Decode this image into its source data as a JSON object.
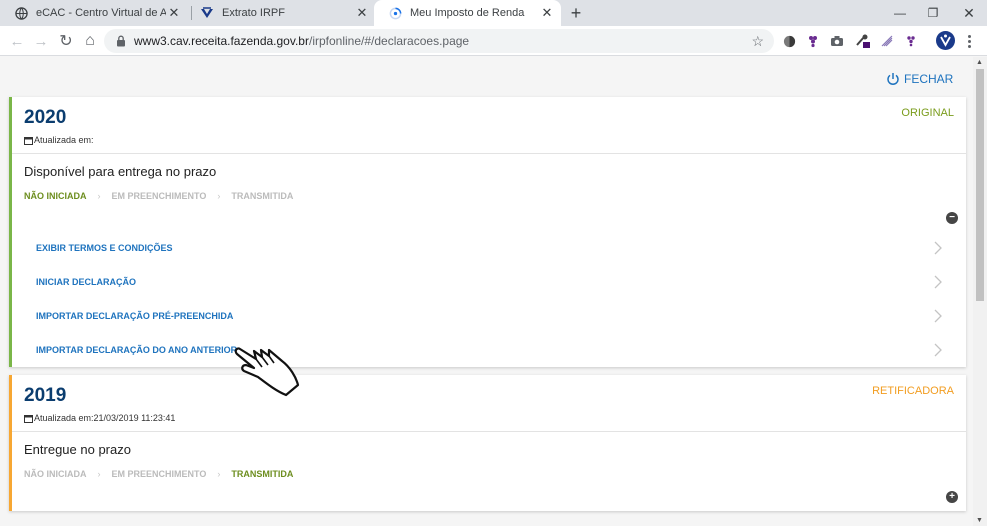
{
  "browser": {
    "tabs": [
      {
        "title": "eCAC - Centro Virtual de Atendim",
        "icon": "globe-icon",
        "active": false
      },
      {
        "title": "Extrato IRPF",
        "icon": "receita-federal-icon",
        "active": false
      },
      {
        "title": "Meu Imposto de Renda",
        "icon": "loading-icon",
        "active": true
      }
    ],
    "new_tab_symbol": "+",
    "window_controls": {
      "minimize": "—",
      "restore": "❐",
      "close": "✕"
    },
    "url_host": "www3.cav.receita.fazenda.gov.br",
    "url_path": "/irpfonline/#/declaracoes.page",
    "nav": {
      "back": "←",
      "forward": "→",
      "reload": "↻",
      "home": "⌂"
    },
    "star": "☆"
  },
  "page": {
    "close_label": "FECHAR",
    "accent": "#1e73be",
    "cards": [
      {
        "year": "2020",
        "status": "ORIGINAL",
        "updated": "Atualizada em:",
        "subtitle": "Disponível para entrega no prazo",
        "steps": [
          "NÃO INICIADA",
          "EM PREENCHIMENTO",
          "TRANSMITIDA"
        ],
        "active_step": 0,
        "toggle": "−",
        "actions": [
          "EXIBIR TERMOS E CONDIÇÕES",
          "INICIAR DECLARAÇÃO",
          "IMPORTAR DECLARAÇÃO PRÉ-PREENCHIDA",
          "IMPORTAR DECLARAÇÃO DO ANO ANTERIOR"
        ]
      },
      {
        "year": "2019",
        "status": "RETIFICADORA",
        "updated": "Atualizada em:21/03/2019 11:23:41",
        "subtitle": "Entregue no prazo",
        "steps": [
          "NÃO INICIADA",
          "EM PREENCHIMENTO",
          "TRANSMITIDA"
        ],
        "active_step": 2,
        "toggle": "+"
      }
    ],
    "step_separator": "›"
  }
}
